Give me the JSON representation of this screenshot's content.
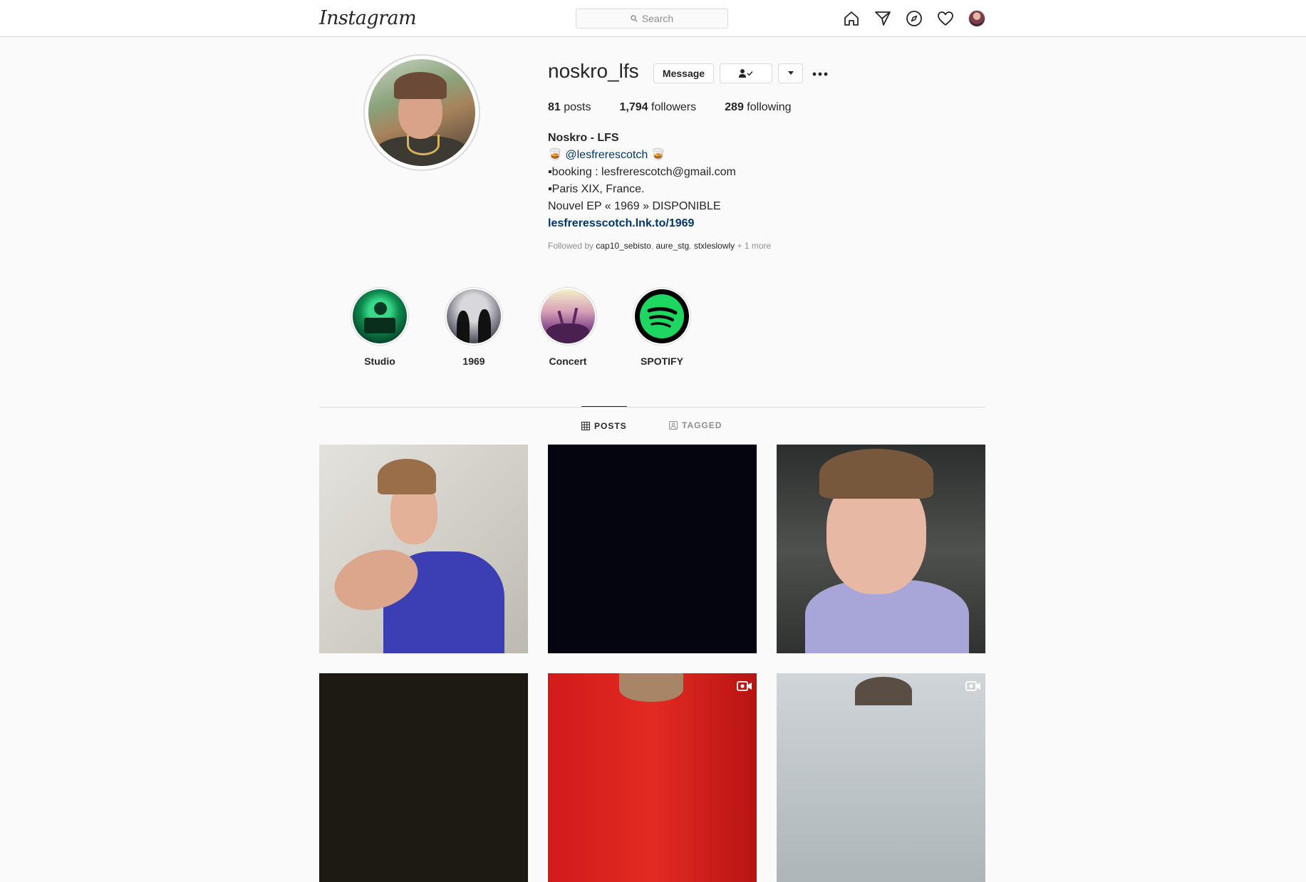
{
  "nav": {
    "logo": "Instagram",
    "search_placeholder": "Search",
    "icons": [
      "home-icon",
      "direct-icon",
      "explore-icon",
      "activity-heart-icon",
      "profile-avatar"
    ]
  },
  "profile": {
    "username": "noskro_lfs",
    "message_label": "Message",
    "stats": {
      "posts_count": "81",
      "posts_label": "posts",
      "followers_count": "1,794",
      "followers_label": "followers",
      "following_count": "289",
      "following_label": "following"
    },
    "bio": {
      "name": "Noskro - LFS",
      "line1_emoji": "🥃",
      "mention": "@lesfrerescotch",
      "line2": "▪booking : lesfrerescotch@gmail.com",
      "line3": "▪Paris XIX, France.",
      "line4": "Nouvel EP « 1969 » DISPONIBLE",
      "link": "lesfreresscotch.lnk.to/1969"
    },
    "followed_by": {
      "prefix": "Followed by",
      "users": [
        "cap10_sebisto",
        "aure_stg",
        "stxleslowly"
      ],
      "more": "+ 1 more"
    }
  },
  "highlights": [
    {
      "label": "Studio"
    },
    {
      "label": "1969"
    },
    {
      "label": "Concert"
    },
    {
      "label": "SPOTIFY"
    }
  ],
  "tabs": {
    "posts": "POSTS",
    "tagged": "TAGGED"
  },
  "colors": {
    "accent_link": "#00376b",
    "border": "#dbdbdb",
    "spotify_green": "#1ed760"
  }
}
